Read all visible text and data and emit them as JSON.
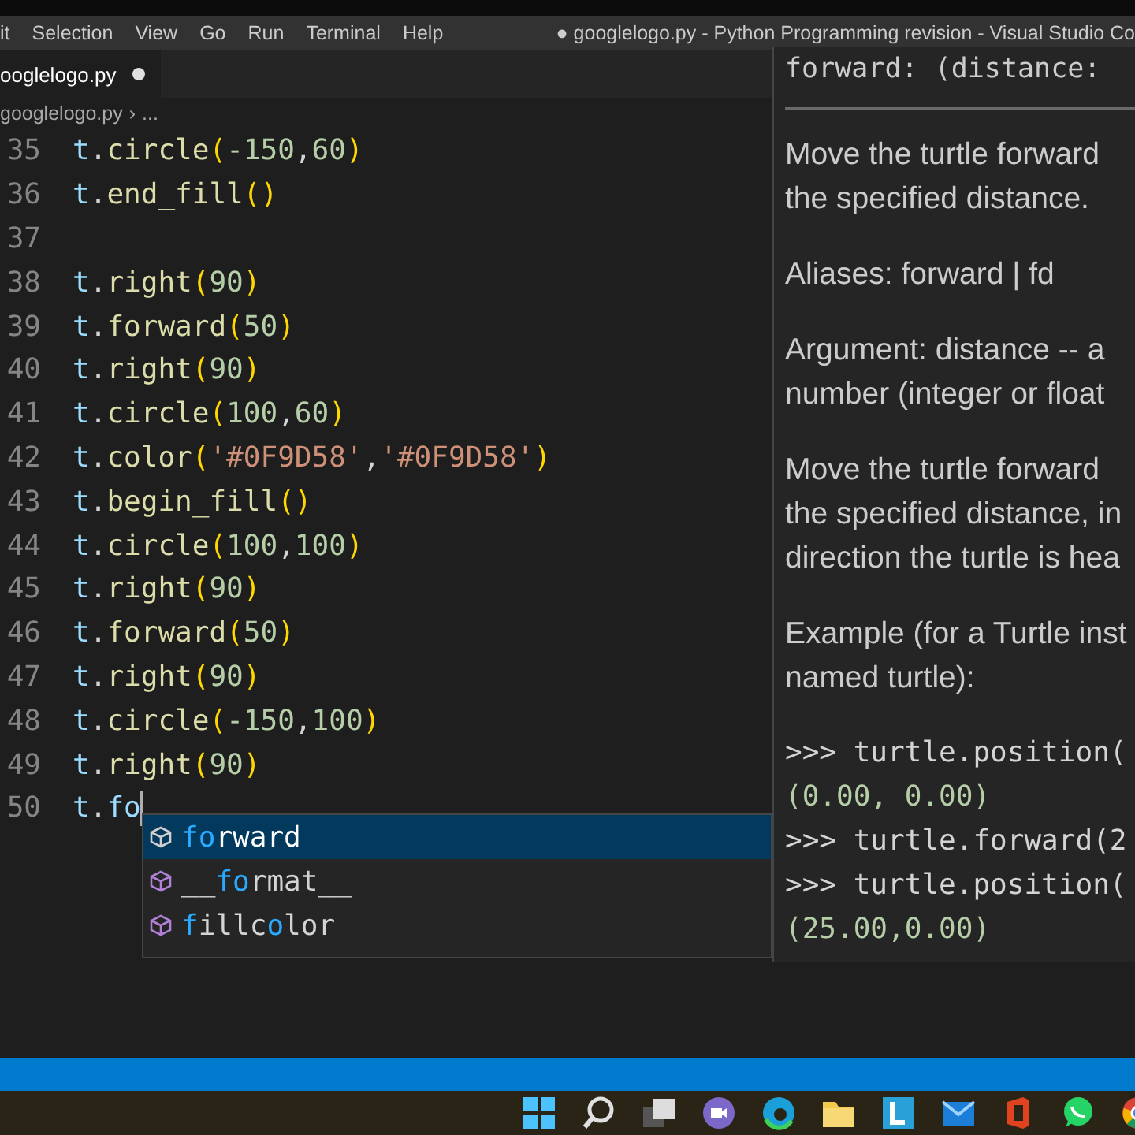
{
  "menu_bar": {
    "items": [
      "it",
      "Selection",
      "View",
      "Go",
      "Run",
      "Terminal",
      "Help"
    ],
    "title": "● googlelogo.py - Python Programming revision - Visual Studio Co"
  },
  "tabs": [
    {
      "label": "ooglelogo.py",
      "modified": true,
      "selected": true
    }
  ],
  "breadcrumb": [
    "googlelogo.py",
    "›",
    "..."
  ],
  "editor": {
    "lines": [
      {
        "number": "35",
        "code": "t.circle(-150,60)"
      },
      {
        "number": "36",
        "code": "t.end_fill()"
      },
      {
        "number": "37"
      },
      {
        "number": "38",
        "code": "t.right(90)"
      },
      {
        "number": "39",
        "code": "t.forward(50)"
      },
      {
        "number": "40",
        "code": "t.right(90)"
      },
      {
        "number": "41",
        "code": "t.circle(100,60)"
      },
      {
        "number": "42",
        "code": "t.color('#0F9D58','#0F9D58')"
      },
      {
        "number": "43",
        "code": "t.begin_fill()"
      },
      {
        "number": "44",
        "code": "t.circle(100,100)"
      },
      {
        "number": "45",
        "code": "t.right(90)"
      },
      {
        "number": "46",
        "code": "t.forward(50)"
      },
      {
        "number": "47",
        "code": "t.right(90)"
      },
      {
        "number": "48",
        "code": "t.circle(-150,100)"
      },
      {
        "number": "49",
        "code": "t.right(90)"
      },
      {
        "number": "50",
        "code": "t.fo",
        "cursor": true
      }
    ]
  },
  "suggestions": [
    {
      "parts": [
        {
          "text": "fo",
          "match": true
        },
        {
          "text": "rward",
          "match": false
        }
      ],
      "selected": true
    },
    {
      "parts": [
        {
          "text": "__",
          "match": false
        },
        {
          "text": "fo",
          "match": true
        },
        {
          "text": "rmat__",
          "match": false
        }
      ],
      "selected": false
    },
    {
      "parts": [
        {
          "text": "f",
          "match": true
        },
        {
          "text": "illc",
          "match": false
        },
        {
          "text": "o",
          "match": true
        },
        {
          "text": "lor",
          "match": false
        }
      ],
      "selected": false
    }
  ],
  "hover": {
    "signature": "forward: (distance:",
    "paragraphs": [
      [
        "Move the turtle forward",
        "the specified distance."
      ],
      [
        "Aliases: forward | fd"
      ],
      [
        "Argument: distance -- a",
        "number (integer or float"
      ],
      [
        "Move the turtle forward",
        "the specified distance, in",
        "direction the turtle is hea"
      ],
      [
        "Example (for a Turtle inst",
        "named turtle):"
      ]
    ],
    "example": [
      ">>> turtle.position(",
      "(0.00, 0.00)",
      ">>> turtle.forward(2",
      ">>> turtle.position(",
      "(25.00,0.00)"
    ]
  }
}
